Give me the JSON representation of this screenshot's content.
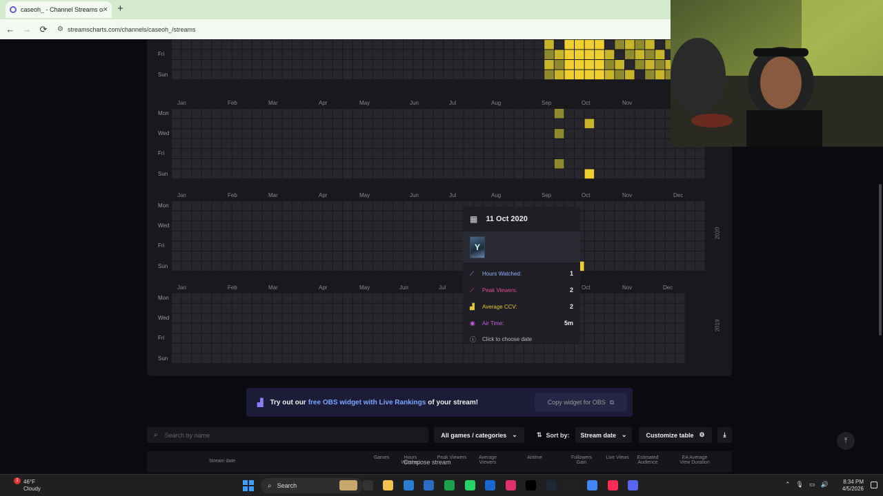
{
  "browser": {
    "tab_title": "caseoh_ - Channel Streams on",
    "tab_close": "×",
    "new_tab": "+",
    "back": "←",
    "forward": "→",
    "reload": "⟳",
    "url": "streamscharts.com/channels/caseoh_/streams"
  },
  "heatmap": {
    "day_labels": [
      "Mon",
      "Wed",
      "Fri",
      "Sun"
    ],
    "month_labels": [
      "Jan",
      "Feb",
      "Mar",
      "Apr",
      "May",
      "Jun",
      "Jul",
      "Aug",
      "Sep",
      "Oct",
      "Nov",
      "Dec"
    ],
    "years": [
      "2020",
      "2019"
    ],
    "colors": {
      "empty": "#26262c",
      "low": "#8f8a2e",
      "mid": "#c8b52a",
      "high": "#f0d030"
    }
  },
  "tooltip": {
    "date": "11 Oct 2020",
    "stats": [
      {
        "label": "Hours Watched:",
        "value": "1",
        "color": "#8fb2ff",
        "icon": "⟋"
      },
      {
        "label": "Peak Viewers:",
        "value": "2",
        "color": "#e0508a",
        "icon": "⟋"
      },
      {
        "label": "Average CCV:",
        "value": "2",
        "color": "#e8c53a",
        "icon": "▟"
      },
      {
        "label": "Air Time:",
        "value": "5m",
        "color": "#c75de0",
        "icon": "((•))"
      }
    ],
    "hint": "Click to choose date"
  },
  "obs_banner": {
    "prefix": "Try out our",
    "link": "free OBS widget with Live Rankings",
    "suffix": "of your stream!",
    "copy_button": "Copy widget for OBS"
  },
  "filters": {
    "search_placeholder": "Search by name",
    "games_dropdown": "All games / categories",
    "sort_label": "Sort by:",
    "sort_value": "Stream date",
    "customize": "Customize table"
  },
  "table_headers": [
    "Stream date",
    "Games",
    "Hours Watched",
    "Peak Viewers",
    "Average Viewers",
    "Airtime",
    "Followers Gain",
    "Live Views",
    "Estimated Audience",
    "EA Average View Duration"
  ],
  "toast": "Compose stream",
  "taskbar": {
    "weather_temp": "46°F",
    "weather_desc": "Cloudy",
    "weather_badge": "1",
    "search": "Search",
    "time": "8:34 PM",
    "date": "4/5/2026"
  }
}
